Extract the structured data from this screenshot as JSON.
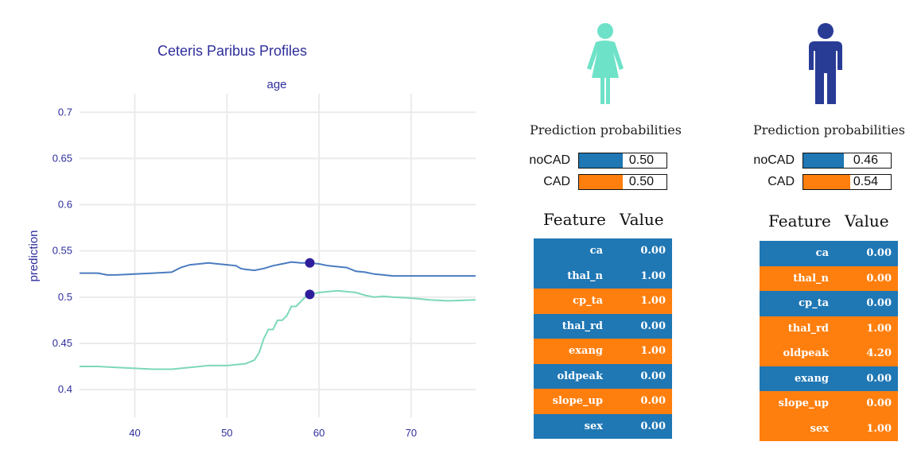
{
  "chart_data": {
    "type": "line",
    "title": "Ceteris Paribus Profiles",
    "subplot_title": "age",
    "ylabel": "prediction",
    "xlim": [
      34,
      77
    ],
    "ylim": [
      0.37,
      0.72
    ],
    "x_ticks": [
      40,
      50,
      60,
      70
    ],
    "y_ticks": [
      0.4,
      0.45,
      0.5,
      0.55,
      0.6,
      0.65,
      0.7
    ],
    "grid": true,
    "series": [
      {
        "color": "#4a7cc0",
        "x": [
          34,
          36,
          37,
          38,
          40,
          42,
          44,
          45,
          46,
          47,
          48,
          49,
          50,
          51,
          51.5,
          52,
          53,
          54,
          55,
          56,
          57,
          58,
          59,
          60,
          61,
          62,
          63,
          64,
          65,
          66,
          67,
          68,
          77
        ],
        "y": [
          0.526,
          0.526,
          0.524,
          0.524,
          0.525,
          0.526,
          0.527,
          0.532,
          0.535,
          0.536,
          0.537,
          0.536,
          0.535,
          0.534,
          0.531,
          0.53,
          0.529,
          0.531,
          0.534,
          0.536,
          0.538,
          0.537,
          0.537,
          0.536,
          0.534,
          0.533,
          0.532,
          0.528,
          0.527,
          0.525,
          0.524,
          0.523,
          0.523
        ]
      },
      {
        "color": "#7dd8b8",
        "x": [
          34,
          36,
          38,
          40,
          42,
          44,
          46,
          48,
          50,
          51,
          52,
          53,
          53.5,
          54,
          54.5,
          55,
          55.5,
          56,
          56.5,
          57,
          57.5,
          58,
          58.5,
          59,
          60,
          61,
          62,
          63,
          64,
          65,
          66,
          67,
          68,
          70,
          72,
          74,
          77
        ],
        "y": [
          0.425,
          0.425,
          0.424,
          0.423,
          0.422,
          0.422,
          0.424,
          0.426,
          0.426,
          0.427,
          0.428,
          0.432,
          0.44,
          0.455,
          0.465,
          0.465,
          0.475,
          0.475,
          0.48,
          0.49,
          0.49,
          0.495,
          0.5,
          0.503,
          0.505,
          0.506,
          0.507,
          0.506,
          0.505,
          0.502,
          0.5,
          0.501,
          0.5,
          0.499,
          0.497,
          0.496,
          0.497
        ]
      }
    ],
    "points": [
      {
        "x": 59,
        "y": 0.537,
        "color": "#2e1e9c"
      },
      {
        "x": 59,
        "y": 0.503,
        "color": "#2e1e9c"
      }
    ]
  },
  "colors": {
    "noCAD": "#1f77b4",
    "CAD": "#ff7f0e",
    "female_icon": "#6ee2c8",
    "male_icon": "#283c96",
    "title_color": "#2e2e9c"
  },
  "left_panel": {
    "icon": "female-person-icon",
    "prob_title": "Prediction probabilities",
    "probs": [
      {
        "label": "noCAD",
        "value": "0.50",
        "fraction": 0.5
      },
      {
        "label": "CAD",
        "value": "0.50",
        "fraction": 0.5
      }
    ],
    "feature_header": "Feature",
    "value_header": "Value",
    "rows": [
      {
        "name": "ca",
        "value": "0.00",
        "cls": "noCAD"
      },
      {
        "name": "thal_n",
        "value": "1.00",
        "cls": "noCAD"
      },
      {
        "name": "cp_ta",
        "value": "1.00",
        "cls": "CAD"
      },
      {
        "name": "thal_rd",
        "value": "0.00",
        "cls": "noCAD"
      },
      {
        "name": "exang",
        "value": "1.00",
        "cls": "CAD"
      },
      {
        "name": "oldpeak",
        "value": "0.00",
        "cls": "noCAD"
      },
      {
        "name": "slope_up",
        "value": "0.00",
        "cls": "CAD"
      },
      {
        "name": "sex",
        "value": "0.00",
        "cls": "noCAD"
      }
    ]
  },
  "right_panel": {
    "icon": "male-person-icon",
    "prob_title": "Prediction probabilities",
    "probs": [
      {
        "label": "noCAD",
        "value": "0.46",
        "fraction": 0.46
      },
      {
        "label": "CAD",
        "value": "0.54",
        "fraction": 0.54
      }
    ],
    "feature_header": "Feature",
    "value_header": "Value",
    "rows": [
      {
        "name": "ca",
        "value": "0.00",
        "cls": "noCAD"
      },
      {
        "name": "thal_n",
        "value": "0.00",
        "cls": "CAD"
      },
      {
        "name": "cp_ta",
        "value": "0.00",
        "cls": "noCAD"
      },
      {
        "name": "thal_rd",
        "value": "1.00",
        "cls": "CAD"
      },
      {
        "name": "oldpeak",
        "value": "4.20",
        "cls": "CAD"
      },
      {
        "name": "exang",
        "value": "0.00",
        "cls": "noCAD"
      },
      {
        "name": "slope_up",
        "value": "0.00",
        "cls": "CAD"
      },
      {
        "name": "sex",
        "value": "1.00",
        "cls": "CAD"
      }
    ]
  }
}
